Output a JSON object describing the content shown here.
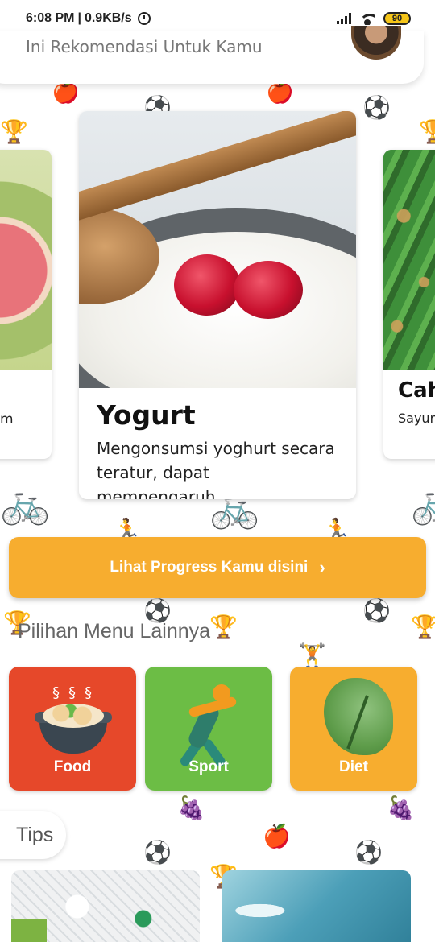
{
  "status_bar": {
    "time": "6:08 PM",
    "network_speed": "0.9KB/s",
    "battery": "90"
  },
  "header": {
    "subtitle": "Ini Rekomendasi Untuk Kamu",
    "avatar_icon": "user-avatar-photo"
  },
  "recommendations": [
    {
      "name": "",
      "description": "m"
    },
    {
      "name": "Yogurt",
      "description": "Mengonsumsi yoghurt secara teratur, dapat mempengaruh..."
    },
    {
      "name": "Cah",
      "description": "Sayur penda"
    }
  ],
  "progress_button": {
    "label": "Lihat Progress Kamu disini",
    "icon": "chevron-right-icon"
  },
  "menu_section": {
    "title": "Pilihan Menu Lainnya",
    "items": [
      {
        "label": "Food",
        "icon": "food-pot-icon",
        "color": "#e6482a"
      },
      {
        "label": "Sport",
        "icon": "runner-icon",
        "color": "#6cbd45"
      },
      {
        "label": "Diet",
        "icon": "lettuce-icon",
        "color": "#f7ad2f"
      }
    ]
  },
  "tips": {
    "label": "Tips"
  },
  "colors": {
    "accent_orange": "#f7ad2f",
    "food_red": "#e6482a",
    "sport_green": "#6cbd45",
    "pattern": "#d4dfc6"
  }
}
